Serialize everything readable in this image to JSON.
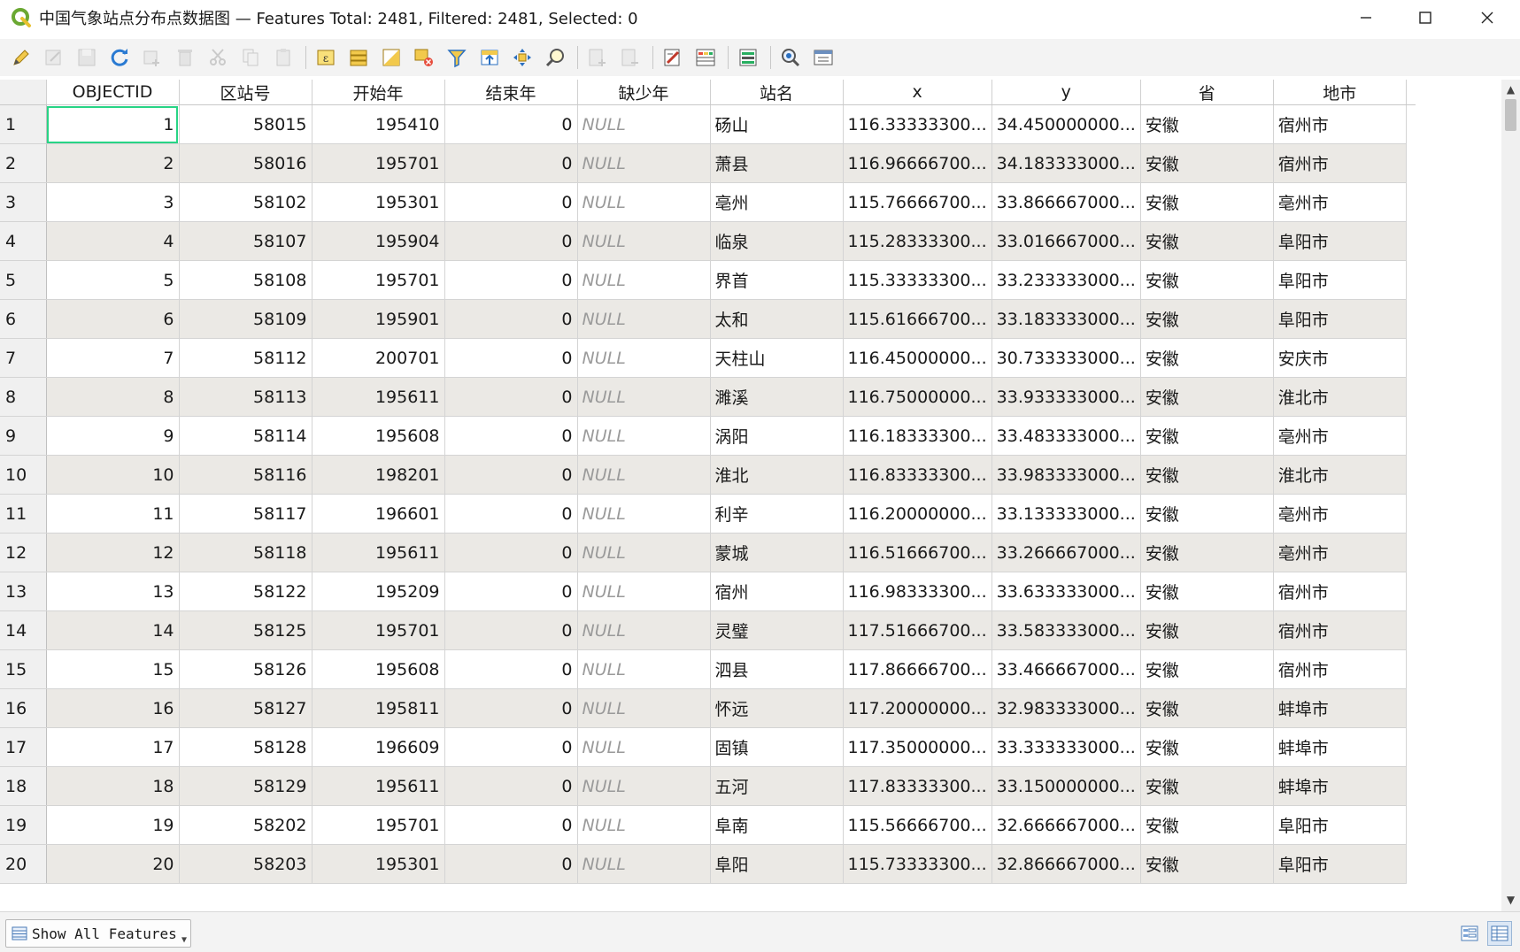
{
  "window": {
    "title": "中国气象站点分布点数据图 — Features Total: 2481, Filtered: 2481, Selected: 0"
  },
  "toolbar": {
    "buttons": [
      {
        "name": "toggle-editing-icon",
        "enabled": true
      },
      {
        "name": "multi-edit-icon",
        "enabled": false
      },
      {
        "name": "save-edits-icon",
        "enabled": false
      },
      {
        "name": "reload-table-icon",
        "enabled": true
      },
      {
        "name": "add-feature-icon",
        "enabled": false
      },
      {
        "name": "delete-features-icon",
        "enabled": false
      },
      {
        "name": "cut-icon",
        "enabled": false
      },
      {
        "name": "copy-icon",
        "enabled": false
      },
      {
        "name": "paste-icon",
        "enabled": false
      },
      {
        "name": "select-by-expression-icon",
        "enabled": true
      },
      {
        "name": "select-all-icon",
        "enabled": true
      },
      {
        "name": "invert-selection-icon",
        "enabled": true
      },
      {
        "name": "deselect-all-icon",
        "enabled": true
      },
      {
        "name": "filter-select-icon",
        "enabled": true
      },
      {
        "name": "move-selection-to-top-icon",
        "enabled": true
      },
      {
        "name": "pan-to-selected-icon",
        "enabled": true
      },
      {
        "name": "zoom-to-selected-icon",
        "enabled": true
      },
      {
        "name": "new-field-icon",
        "enabled": false
      },
      {
        "name": "delete-field-icon",
        "enabled": false
      },
      {
        "name": "field-calculator-icon",
        "enabled": true
      },
      {
        "name": "conditional-formatting-icon",
        "enabled": true
      },
      {
        "name": "organize-columns-icon",
        "enabled": true
      },
      {
        "name": "actions-icon",
        "enabled": true
      },
      {
        "name": "dock-icon",
        "enabled": true
      }
    ]
  },
  "table": {
    "columns": [
      "OBJECTID",
      "区站号",
      "开始年",
      "结束年",
      "缺少年",
      "站名",
      "x",
      "y",
      "省",
      "地市"
    ],
    "rows": [
      {
        "n": "1",
        "c": [
          "1",
          "58015",
          "195410",
          "0",
          "NULL",
          "砀山",
          "116.33333300...",
          "34.450000000...",
          "安徽",
          "宿州市"
        ]
      },
      {
        "n": "2",
        "c": [
          "2",
          "58016",
          "195701",
          "0",
          "NULL",
          "萧县",
          "116.96666700...",
          "34.183333000...",
          "安徽",
          "宿州市"
        ]
      },
      {
        "n": "3",
        "c": [
          "3",
          "58102",
          "195301",
          "0",
          "NULL",
          "亳州",
          "115.76666700...",
          "33.866667000...",
          "安徽",
          "亳州市"
        ]
      },
      {
        "n": "4",
        "c": [
          "4",
          "58107",
          "195904",
          "0",
          "NULL",
          "临泉",
          "115.28333300...",
          "33.016667000...",
          "安徽",
          "阜阳市"
        ]
      },
      {
        "n": "5",
        "c": [
          "5",
          "58108",
          "195701",
          "0",
          "NULL",
          "界首",
          "115.33333300...",
          "33.233333000...",
          "安徽",
          "阜阳市"
        ]
      },
      {
        "n": "6",
        "c": [
          "6",
          "58109",
          "195901",
          "0",
          "NULL",
          "太和",
          "115.61666700...",
          "33.183333000...",
          "安徽",
          "阜阳市"
        ]
      },
      {
        "n": "7",
        "c": [
          "7",
          "58112",
          "200701",
          "0",
          "NULL",
          "天柱山",
          "116.45000000...",
          "30.733333000...",
          "安徽",
          "安庆市"
        ]
      },
      {
        "n": "8",
        "c": [
          "8",
          "58113",
          "195611",
          "0",
          "NULL",
          "濉溪",
          "116.75000000...",
          "33.933333000...",
          "安徽",
          "淮北市"
        ]
      },
      {
        "n": "9",
        "c": [
          "9",
          "58114",
          "195608",
          "0",
          "NULL",
          "涡阳",
          "116.18333300...",
          "33.483333000...",
          "安徽",
          "亳州市"
        ]
      },
      {
        "n": "10",
        "c": [
          "10",
          "58116",
          "198201",
          "0",
          "NULL",
          "淮北",
          "116.83333300...",
          "33.983333000...",
          "安徽",
          "淮北市"
        ]
      },
      {
        "n": "11",
        "c": [
          "11",
          "58117",
          "196601",
          "0",
          "NULL",
          "利辛",
          "116.20000000...",
          "33.133333000...",
          "安徽",
          "亳州市"
        ]
      },
      {
        "n": "12",
        "c": [
          "12",
          "58118",
          "195611",
          "0",
          "NULL",
          "蒙城",
          "116.51666700...",
          "33.266667000...",
          "安徽",
          "亳州市"
        ]
      },
      {
        "n": "13",
        "c": [
          "13",
          "58122",
          "195209",
          "0",
          "NULL",
          "宿州",
          "116.98333300...",
          "33.633333000...",
          "安徽",
          "宿州市"
        ]
      },
      {
        "n": "14",
        "c": [
          "14",
          "58125",
          "195701",
          "0",
          "NULL",
          "灵璧",
          "117.51666700...",
          "33.583333000...",
          "安徽",
          "宿州市"
        ]
      },
      {
        "n": "15",
        "c": [
          "15",
          "58126",
          "195608",
          "0",
          "NULL",
          "泗县",
          "117.86666700...",
          "33.466667000...",
          "安徽",
          "宿州市"
        ]
      },
      {
        "n": "16",
        "c": [
          "16",
          "58127",
          "195811",
          "0",
          "NULL",
          "怀远",
          "117.20000000...",
          "32.983333000...",
          "安徽",
          "蚌埠市"
        ]
      },
      {
        "n": "17",
        "c": [
          "17",
          "58128",
          "196609",
          "0",
          "NULL",
          "固镇",
          "117.35000000...",
          "33.333333000...",
          "安徽",
          "蚌埠市"
        ]
      },
      {
        "n": "18",
        "c": [
          "18",
          "58129",
          "195611",
          "0",
          "NULL",
          "五河",
          "117.83333300...",
          "33.150000000...",
          "安徽",
          "蚌埠市"
        ]
      },
      {
        "n": "19",
        "c": [
          "19",
          "58202",
          "195701",
          "0",
          "NULL",
          "阜南",
          "115.56666700...",
          "32.666667000...",
          "安徽",
          "阜阳市"
        ]
      },
      {
        "n": "20",
        "c": [
          "20",
          "58203",
          "195301",
          "0",
          "NULL",
          "阜阳",
          "115.73333300...",
          "32.866667000...",
          "安徽",
          "阜阳市"
        ]
      }
    ]
  },
  "footer": {
    "show_all_label": "Show All Features"
  }
}
